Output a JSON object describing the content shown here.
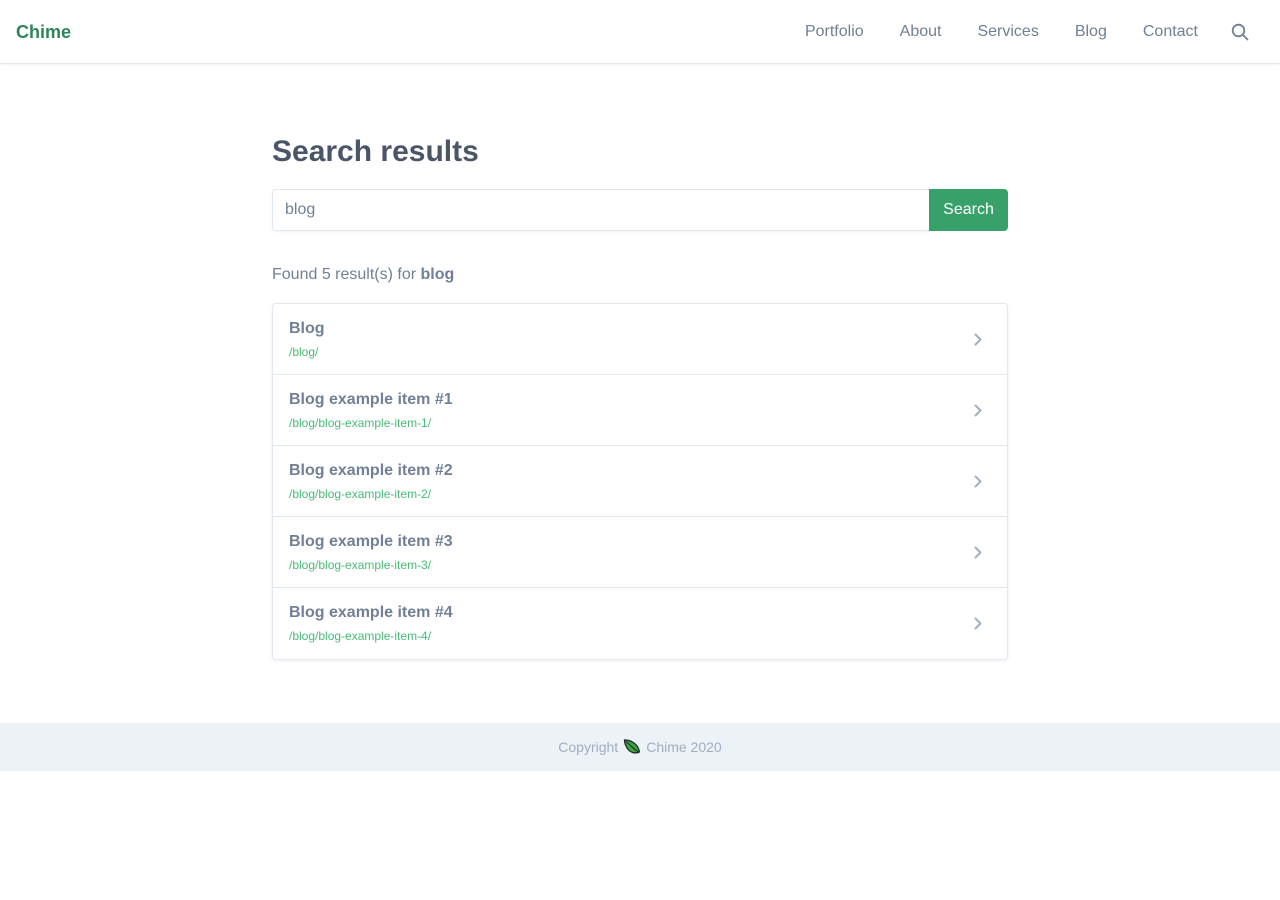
{
  "brand": "Chime",
  "nav": {
    "items": [
      {
        "label": "Portfolio"
      },
      {
        "label": "About"
      },
      {
        "label": "Services"
      },
      {
        "label": "Blog"
      },
      {
        "label": "Contact"
      }
    ],
    "search_icon": "search-icon"
  },
  "main": {
    "title": "Search results",
    "search": {
      "value": "blog",
      "button_label": "Search"
    },
    "summary": {
      "prefix": "Found 5 result(s) for",
      "query": "blog"
    },
    "results": [
      {
        "title": "Blog",
        "url": "/blog/"
      },
      {
        "title": "Blog example item #1",
        "url": "/blog/blog-example-item-1/"
      },
      {
        "title": "Blog example item #2",
        "url": "/blog/blog-example-item-2/"
      },
      {
        "title": "Blog example item #3",
        "url": "/blog/blog-example-item-3/"
      },
      {
        "title": "Blog example item #4",
        "url": "/blog/blog-example-item-4/"
      }
    ]
  },
  "footer": {
    "copyright": "Copyright",
    "site": "Chime 2020",
    "icon": "leaf-icon"
  },
  "colors": {
    "accent": "#38a169",
    "brand": "#2f855a",
    "url": "#48bb78",
    "text": "#718096",
    "footer_bg": "#edf2f7"
  }
}
